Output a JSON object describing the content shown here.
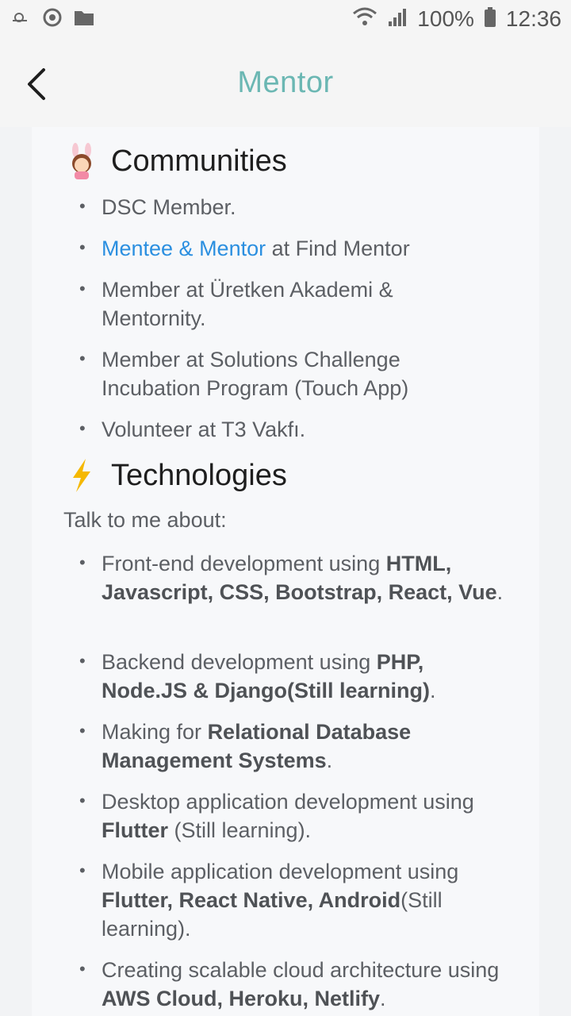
{
  "status_bar": {
    "battery": "100%",
    "time": "12:36"
  },
  "header": {
    "title": "Mentor"
  },
  "communities": {
    "heading": "Communities",
    "items": [
      {
        "text": "DSC Member."
      },
      {
        "link": "Mentee & Mentor",
        "rest": " at Find Mentor"
      },
      {
        "line1": "Member at Üretken Akademi &",
        "line2": "Mentornity."
      },
      {
        "line1": "Member at Solutions Challenge",
        "line2": "Incubation Program (Touch App)"
      },
      {
        "text": "Volunteer at T3 Vakfı."
      }
    ]
  },
  "technologies": {
    "heading": "Technologies",
    "intro": "Talk to me about:",
    "items": [
      {
        "pre": "Front-end development using ",
        "bold": "HTML, Javascript, CSS, Bootstrap, React, Vue",
        "post": "."
      },
      {
        "pre": "Backend development using ",
        "bold": "PHP, Node.JS & Django(Still learning)",
        "post": "."
      },
      {
        "pre": "Making for ",
        "bold": "Relational Database Management Systems",
        "post": "."
      },
      {
        "pre": "Desktop application development using ",
        "bold": "Flutter",
        "post": " (Still learning)."
      },
      {
        "pre": "Mobile application development using ",
        "bold": "Flutter, React Native, Android",
        "post": "(Still learning)."
      },
      {
        "pre": "Creating scalable cloud architecture using ",
        "bold": "AWS Cloud, Heroku, Netlify",
        "post": "."
      }
    ]
  },
  "colors": {
    "title": "#6bb7b3",
    "link": "#2b8fe0"
  }
}
